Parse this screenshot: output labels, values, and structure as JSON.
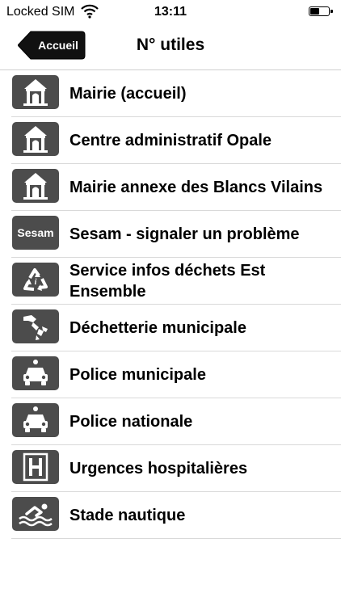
{
  "status_bar": {
    "carrier": "Locked SIM",
    "time": "13:11"
  },
  "nav": {
    "back_label": "Accueil",
    "title": "N° utiles"
  },
  "items": [
    {
      "label": "Mairie (accueil)",
      "icon": "town-hall-icon"
    },
    {
      "label": "Centre administratif Opale",
      "icon": "town-hall-icon"
    },
    {
      "label": "Mairie annexe des Blancs Vilains",
      "icon": "town-hall-icon"
    },
    {
      "label": "Sesam - signaler un problème",
      "icon": "sesam-logo-icon",
      "icon_text": "Sesam"
    },
    {
      "label": "Service infos déchets Est Ensemble",
      "icon": "recycling-icon"
    },
    {
      "label": "Déchetterie municipale",
      "icon": "waste-disposal-icon"
    },
    {
      "label": "Police municipale",
      "icon": "police-car-icon"
    },
    {
      "label": "Police nationale",
      "icon": "police-car-icon"
    },
    {
      "label": "Urgences hospitalières",
      "icon": "hospital-icon"
    },
    {
      "label": "Stade nautique",
      "icon": "swimming-icon"
    }
  ],
  "colors": {
    "icon_background": "#4c4c4c",
    "divider": "#d9d9d9"
  }
}
